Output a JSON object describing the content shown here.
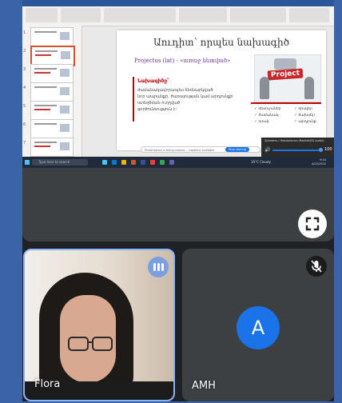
{
  "shared_screen": {
    "slide": {
      "title": "Աուդիտ՝ որպես նախագիծ",
      "subtitle": "Projectus (lat) - «առաջ նետված»",
      "box_heading": "Նախագիծը՝",
      "box_lines": [
        "ժամանակավորապես ձեռնարկված",
        "նոր ապրանքի, ծառայության կամ արդյունքի",
        "ստեղծման ուղղված",
        "գործունեություն է:"
      ],
      "image_label": "Project",
      "bullets": [
        "ռեսուրսներ",
        "ռիսկեր",
        "ժամանակ",
        "ծախսեր",
        "որակ",
        "արդյունք"
      ]
    },
    "thumbnail_numbers": [
      "1",
      "2",
      "3",
      "4",
      "5",
      "6",
      "7"
    ],
    "notes_bar_text": "Presentation is being shared — captions available",
    "notes_button": "Stop sharing",
    "volume_popup": {
      "device": "Speakers / Headphones (Realtek(R) Audio)",
      "value": "100"
    },
    "taskbar": {
      "search_placeholder": "Type here to search",
      "weather": "16°C Cloudy",
      "time": "9:04",
      "date": "4/22/2022"
    }
  },
  "participants": [
    {
      "name": "Flora",
      "speaking": true
    },
    {
      "name": "AMH",
      "avatar_letter": "A",
      "muted": true
    }
  ],
  "colors": {
    "page_bg": "#3a63a8",
    "panel_bg": "#202124",
    "tile_bg": "#3c4043",
    "avatar_bg": "#1a73e8",
    "speaking_ring": "#8ab4f8",
    "accent_red": "#c00000"
  },
  "icons": {
    "fullscreen": "fullscreen-icon",
    "speaking": "audio-bars-icon",
    "muted": "mic-off-icon"
  }
}
